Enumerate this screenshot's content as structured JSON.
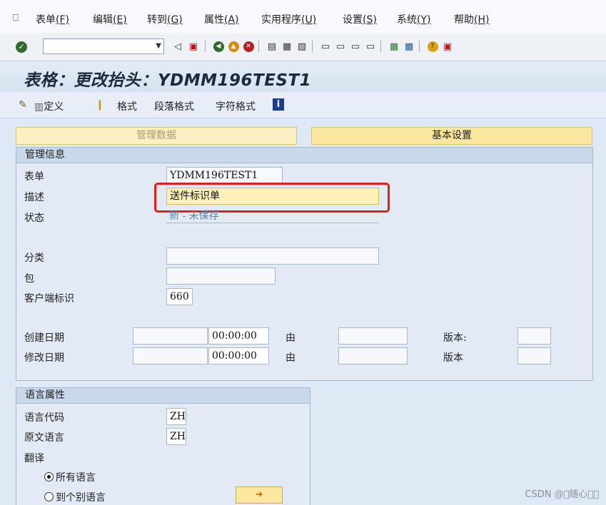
{
  "menu": {
    "items": [
      {
        "label": "表单",
        "key": "(F)"
      },
      {
        "label": "编辑",
        "key": "(E)"
      },
      {
        "label": "转到",
        "key": "(G)"
      },
      {
        "label": "属性",
        "key": "(A)"
      },
      {
        "label": "实用程序",
        "key": "(U)"
      },
      {
        "label": "设置",
        "key": "(S)"
      },
      {
        "label": "系统",
        "key": "(Y)"
      },
      {
        "label": "帮助",
        "key": "(H)"
      }
    ]
  },
  "toolbar": {
    "command_value": ""
  },
  "title": "表格：更改抬头：YDMM196TEST1",
  "app_toolbar": {
    "define_label": "定义",
    "format_label": "格式",
    "paragraph_format_label": "段落格式",
    "char_format_label": "字符格式"
  },
  "tabs": {
    "admin_data": "管理数据",
    "basic_settings": "基本设置"
  },
  "admin_group": {
    "title": "管理信息",
    "form_label": "表单",
    "form_value": "YDMM196TEST1",
    "desc_label": "描述",
    "desc_value": "送件标识单",
    "status_label": "状态",
    "status_value": "新 - 未保存",
    "class_label": "分类",
    "class_value": "",
    "package_label": "包",
    "package_value": "",
    "client_label": "客户端标识",
    "client_value": "660",
    "created_label": "创建日期",
    "created_date": "",
    "created_time": "00:00:00",
    "created_by_label": "由",
    "created_by": "",
    "created_version_label": "版本:",
    "created_version": "",
    "changed_label": "修改日期",
    "changed_date": "",
    "changed_time": "00:00:00",
    "changed_by_label": "由",
    "changed_by": "",
    "changed_version_label": "版本",
    "changed_version": ""
  },
  "lang_group": {
    "title": "语言属性",
    "lang_code_label": "语言代码",
    "lang_code_value": "ZH",
    "orig_lang_label": "原文语言",
    "orig_lang_value": "ZH",
    "translate_label": "翻译",
    "all_langs_label": "所有语言",
    "single_lang_label": "到个别语言"
  },
  "watermark": "CSDN @\u0000随心\u0000\u0000"
}
